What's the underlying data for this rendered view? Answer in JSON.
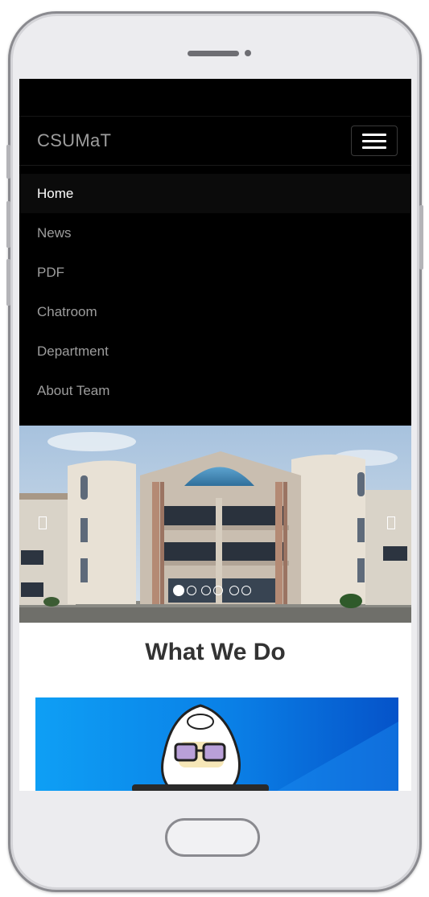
{
  "navbar": {
    "brand": "CSUMaT"
  },
  "menu": {
    "items": [
      {
        "label": "Home",
        "active": true
      },
      {
        "label": "News"
      },
      {
        "label": "PDF"
      },
      {
        "label": "Chatroom"
      },
      {
        "label": "Department"
      },
      {
        "label": "About Team"
      }
    ]
  },
  "carousel": {
    "slide_count": 6,
    "active_index": 0
  },
  "section": {
    "title": "What We Do"
  },
  "colors": {
    "navbar_bg": "#000000",
    "nav_text": "#9d9d9d",
    "active_text": "#ffffff",
    "heading": "#333333",
    "feature_bg": "#0a84e8"
  }
}
